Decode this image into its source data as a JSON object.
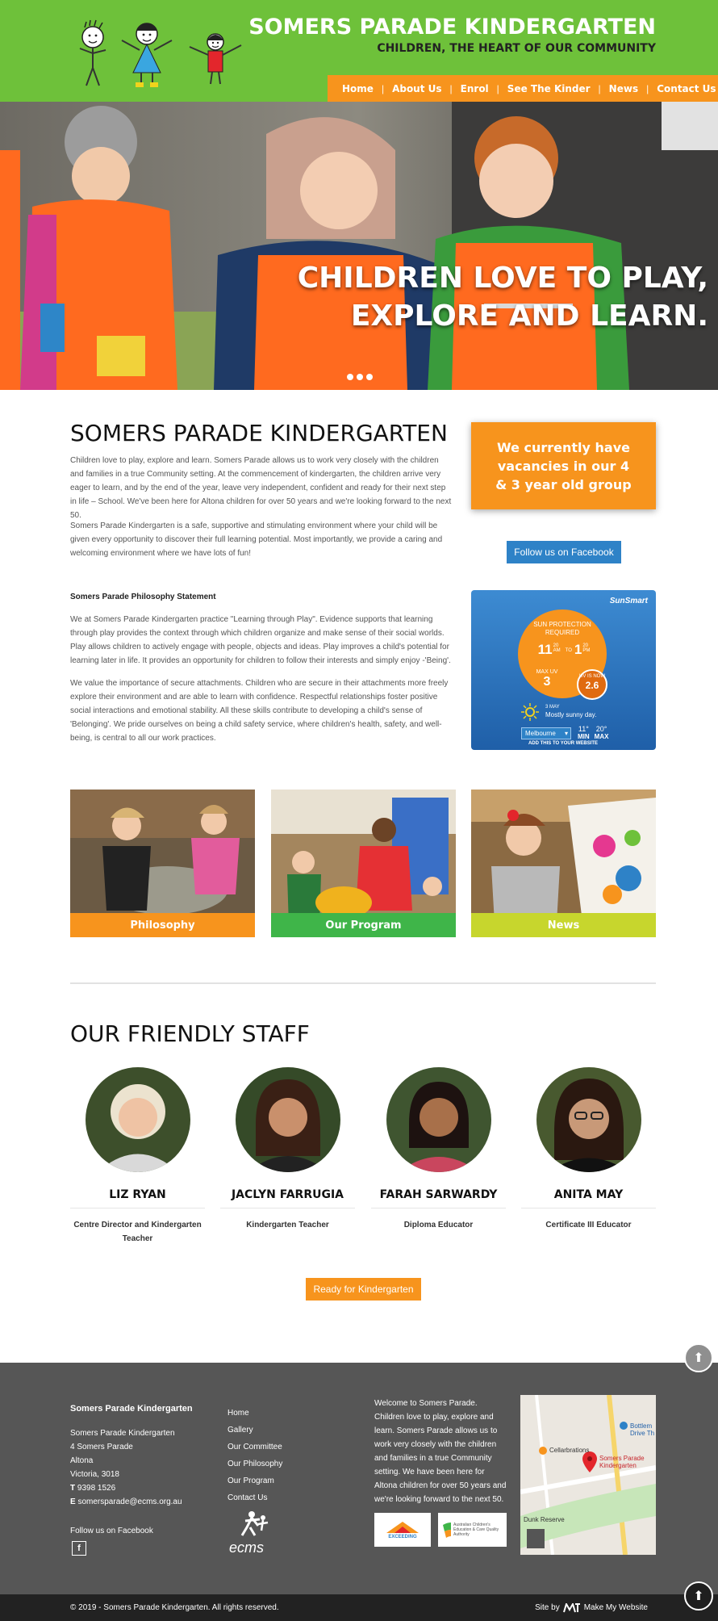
{
  "header": {
    "title": "SOMERS PARADE KINDERGARTEN",
    "tagline": "CHILDREN, THE HEART OF OUR COMMUNITY"
  },
  "nav": {
    "items": [
      "Home",
      "About Us",
      "Enrol",
      "See The Kinder",
      "News",
      "Contact Us"
    ]
  },
  "hero": {
    "line1": "CHILDREN LOVE TO PLAY,",
    "line2": "EXPLORE AND LEARN.",
    "slide_count": 3
  },
  "intro": {
    "title": "SOMERS PARADE KINDERGARTEN",
    "para1": "Children love to play, explore and learn. Somers Parade allows us to work very closely with the children and families in a true Community setting. At the commencement of kindergarten, the children arrive very eager to learn, and by the end of the year, leave very independent, confident and ready for their next step in life – School. We've been here for Altona children for over 50 years and we're looking forward to the next 50.",
    "para2": "Somers Parade Kindergarten is a safe, supportive and stimulating environment where your child will be given every opportunity to discover their full learning potential. Most importantly, we provide a caring and welcoming environment where we have lots of fun!"
  },
  "vacancy": {
    "text": "We currently have vacancies in our 4 & 3 year old group"
  },
  "facebook_button": "Follow us on Facebook",
  "philosophy": {
    "heading": "Somers Parade Philosophy Statement",
    "para1": "We at Somers Parade Kindergarten practice \"Learning through Play\". Evidence supports that learning through play provides the context through which children organize and make sense of their social worlds. Play allows children to actively engage with people, objects and ideas. Play improves a child's potential for learning later in life. It provides an opportunity for children to follow their interests and simply enjoy -'Being'.",
    "para2": "We value the importance of secure attachments. Children who are secure in their attachments more freely explore their environment and are able to learn with confidence. Respectful relationships foster positive social interactions and emotional stability. All these skills contribute to developing a child's sense of 'Belonging'. We pride ourselves on being a child safety service, where children's health, safety, and well-being, is central to all our work practices."
  },
  "sunsmart": {
    "brand": "SunSmart",
    "protection_label": "SUN PROTECTION REQUIRED",
    "from_hour": "11",
    "from_min": "20",
    "from_ampm": "AM",
    "to_word": "TO",
    "to_hour": "1",
    "to_min": "20",
    "to_ampm": "PM",
    "max_uv_label": "MAX UV",
    "max_uv": "3",
    "uv_now_label": "UV IS NOW",
    "uv_now": "2.6",
    "date": "3 MAY",
    "forecast": "Mostly sunny day.",
    "location": "Melbourne",
    "min_temp": "11°",
    "min_label": "MIN",
    "max_temp": "20°",
    "max_label": "MAX",
    "cta": "ADD THIS TO YOUR WEBSITE"
  },
  "tiles": [
    {
      "label": "Philosophy",
      "color": "#f7941d"
    },
    {
      "label": "Our Program",
      "color": "#3fb549"
    },
    {
      "label": "News",
      "color": "#c7d62d"
    }
  ],
  "staff": {
    "heading": "OUR FRIENDLY STAFF",
    "members": [
      {
        "name": "LIZ RYAN",
        "role": "Centre Director and Kindergarten Teacher"
      },
      {
        "name": "JACLYN FARRUGIA",
        "role": "Kindergarten Teacher"
      },
      {
        "name": "FARAH SARWARDY",
        "role": "Diploma Educator"
      },
      {
        "name": "ANITA MAY",
        "role": "Certificate III Educator"
      }
    ]
  },
  "ready_button": "Ready for Kindergarten",
  "footer": {
    "org_heading": "Somers Parade Kindergarten",
    "address_lines": [
      "Somers Parade Kindergarten",
      "4 Somers Parade",
      "Altona",
      "Victoria, 3018"
    ],
    "phone_label": "T",
    "phone": "9398 1526",
    "email_label": "E",
    "email": "somersparade@ecms.org.au",
    "follow": "Follow us on Facebook",
    "links": [
      "Home",
      "Gallery",
      "Our Committee",
      "Our Philosophy",
      "Our Program",
      "Contact Us"
    ],
    "ecms_logo": "ecms",
    "about": "Welcome to Somers Parade. Children love to play, explore and learn. Somers Parade allows us to work very closely with the children and families in a true Community setting. We have been here for Altona children for over 50 years and we're looking forward to the next 50.",
    "badge1": "EXCEEDING",
    "badge2": "Australian Children's Education & Care Quality Authority",
    "map_labels": [
      "Cellarbrations",
      "Bottlem Drive Th",
      "Somers Parade Kindergarten",
      "Dunk Reserve"
    ]
  },
  "bottom_bar": {
    "copyright": "© 2019 - Somers Parade Kindergarten. All rights reserved.",
    "site_by": "Site by",
    "credit": "Make My Website"
  },
  "colors": {
    "header_green": "#6ec13a",
    "accent_orange": "#f7941d",
    "facebook_blue": "#2e82c7",
    "footer_gray": "#565656"
  }
}
